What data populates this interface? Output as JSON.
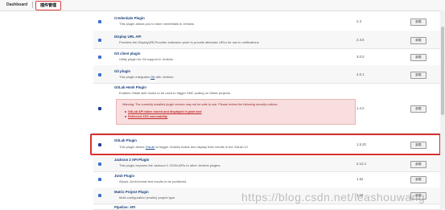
{
  "header": {
    "breadcrumb_dashboard": "Dashboard",
    "breadcrumb_plugins": "插件管理"
  },
  "plugins": [
    {
      "name": "Credentials Plugin",
      "desc": "This plugin allows you to store credentials in Jenkins.",
      "version": "2.3",
      "checked": false
    },
    {
      "name": "Display URL API",
      "desc": "Provides the DisplayURLProvider extension point to provide alternate URLs for use in notifications",
      "version": "2.3.5",
      "checked": false
    },
    {
      "name": "Git client plugin",
      "desc": "Utility plugin for Git support in Jenkins",
      "version": "3.0.0",
      "checked": false
    },
    {
      "name": "Git plugin",
      "desc": "This plugin integrates",
      "desc_link": "Git",
      "desc_after": "with Jenkins.",
      "version": "4.0.1",
      "checked": false
    },
    {
      "name": "GitLab Hook Plugin",
      "desc": "Enables Gitlab web hooks to be used to trigger SMC polling on Gitlab projects",
      "version": "1.4.2",
      "checked": true
    },
    {
      "name": "GitLab Plugin",
      "desc": "This plugin allows",
      "desc_link": "GitLab",
      "desc_after": "to trigger Jenkins builds and display their results in the GitLab UI.",
      "version": "1.5.20",
      "checked": true
    },
    {
      "name": "Jackson 2 API Plugin",
      "desc": "This plugin exposes the Jackson 2 JSON APIs to other Jenkins plugins.",
      "version": "2.12.4",
      "checked": false
    },
    {
      "name": "JUnit Plugin",
      "desc": "Allows JUnit-format test results to be published.",
      "version": "1.52",
      "checked": false
    },
    {
      "name": "Matrix Project Plugin",
      "desc": "Multi-configuration (matrix) project type.",
      "version": "1.19",
      "checked": false
    },
    {
      "name": "Pipeline: API",
      "desc": "",
      "version": "",
      "checked": false
    }
  ],
  "warning": {
    "message": "Warning: The currently installed plugin version may not be safe to use. Please review the following security notices:",
    "items": [
      "GitLab API token stored and displayed in plain text",
      "Reflected XSS vulnerability"
    ]
  },
  "uninstall_label": "卸载",
  "watermark": "https://blog.csdn.net/leashouwang"
}
